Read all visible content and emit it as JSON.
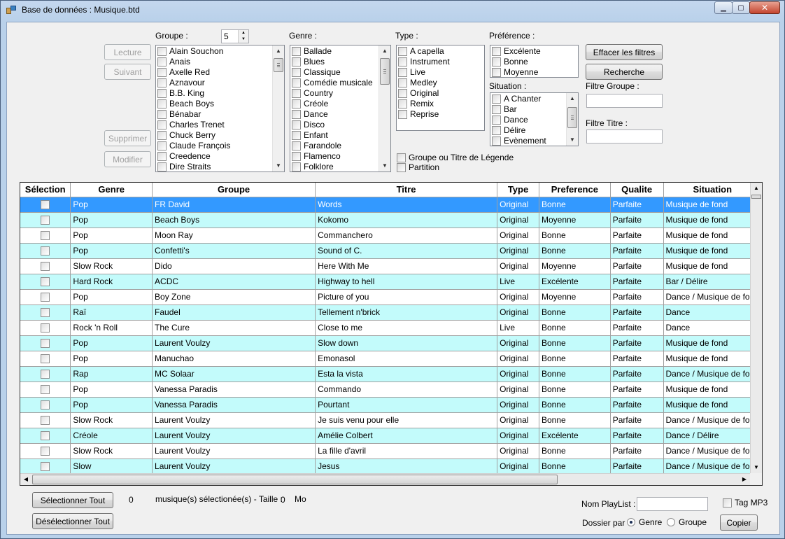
{
  "window": {
    "title": "Base de données : Musique.btd"
  },
  "left_buttons": {
    "lecture": "Lecture",
    "suivant": "Suivant",
    "supprimer": "Supprimer",
    "modifier": "Modifier"
  },
  "groupe": {
    "label": "Groupe :",
    "spinner_value": "5",
    "items": [
      "Alain Souchon",
      "Anais",
      "Axelle Red",
      "Aznavour",
      "B.B. King",
      "Beach Boys",
      "Bénabar",
      "Charles Trenet",
      "Chuck Berry",
      "Claude François",
      "Creedence",
      "Dire Straits"
    ]
  },
  "genre": {
    "label": "Genre :",
    "items": [
      "Ballade",
      "Blues",
      "Classique",
      "Comédie musicale",
      "Country",
      "Créole",
      "Dance",
      "Disco",
      "Enfant",
      "Farandole",
      "Flamenco",
      "Folklore"
    ]
  },
  "type": {
    "label": "Type :",
    "items": [
      "A capella",
      "Instrument",
      "Live",
      "Medley",
      "Original",
      "Remix",
      "Reprise"
    ]
  },
  "preference": {
    "label": "Préférence :",
    "items": [
      "Excélente",
      "Bonne",
      "Moyenne"
    ]
  },
  "situation": {
    "label": "Situation :",
    "items": [
      "A Chanter",
      "Bar",
      "Dance",
      "Délire",
      "Evènement"
    ]
  },
  "options": {
    "legende": "Groupe ou Titre de Légende",
    "partition": "Partition"
  },
  "right_panel": {
    "effacer": "Effacer les filtres",
    "recherche": "Recherche",
    "filtre_groupe": "Filtre Groupe :",
    "filtre_titre": "Filtre Titre :"
  },
  "grid": {
    "columns": [
      "Sélection",
      "Genre",
      "Groupe",
      "Titre",
      "Type",
      "Preference",
      "Qualite",
      "Situation"
    ],
    "rows": [
      [
        "Pop",
        "FR David",
        "Words",
        "Original",
        "Bonne",
        "Parfaite",
        "Musique de fond"
      ],
      [
        "Pop",
        "Beach Boys",
        "Kokomo",
        "Original",
        "Moyenne",
        "Parfaite",
        "Musique de fond"
      ],
      [
        "Pop",
        "Moon Ray",
        "Commanchero",
        "Original",
        "Bonne",
        "Parfaite",
        "Musique de fond"
      ],
      [
        "Pop",
        "Confetti's",
        "Sound of C.",
        "Original",
        "Bonne",
        "Parfaite",
        "Musique de fond"
      ],
      [
        "Slow Rock",
        "Dido",
        "Here With Me",
        "Original",
        "Moyenne",
        "Parfaite",
        "Musique de fond"
      ],
      [
        "Hard Rock",
        "ACDC",
        "Highway to hell",
        "Live",
        "Excélente",
        "Parfaite",
        "Bar / Délire"
      ],
      [
        "Pop",
        "Boy Zone",
        "Picture of you",
        "Original",
        "Moyenne",
        "Parfaite",
        "Dance / Musique de fond"
      ],
      [
        "Raï",
        "Faudel",
        "Tellement n'brick",
        "Original",
        "Bonne",
        "Parfaite",
        "Dance"
      ],
      [
        "Rock 'n Roll",
        "The Cure",
        "Close to me",
        "Live",
        "Bonne",
        "Parfaite",
        "Dance"
      ],
      [
        "Pop",
        "Laurent Voulzy",
        "Slow down",
        "Original",
        "Bonne",
        "Parfaite",
        "Musique de fond"
      ],
      [
        "Pop",
        "Manuchao",
        "Emonasol",
        "Original",
        "Bonne",
        "Parfaite",
        "Musique de fond"
      ],
      [
        "Rap",
        "MC Solaar",
        "Esta la vista",
        "Original",
        "Bonne",
        "Parfaite",
        "Dance / Musique de fond"
      ],
      [
        "Pop",
        "Vanessa Paradis",
        "Commando",
        "Original",
        "Bonne",
        "Parfaite",
        "Musique de fond"
      ],
      [
        "Pop",
        "Vanessa Paradis",
        "Pourtant",
        "Original",
        "Bonne",
        "Parfaite",
        "Musique de fond"
      ],
      [
        "Slow Rock",
        "Laurent Voulzy",
        "Je suis venu pour elle",
        "Original",
        "Bonne",
        "Parfaite",
        "Dance / Musique de fond"
      ],
      [
        "Créole",
        "Laurent Voulzy",
        "Amélie Colbert",
        "Original",
        "Excélente",
        "Parfaite",
        "Dance / Délire"
      ],
      [
        "Slow Rock",
        "Laurent Voulzy",
        "La fille d'avril",
        "Original",
        "Bonne",
        "Parfaite",
        "Dance / Musique de fond"
      ],
      [
        "Slow",
        "Laurent Voulzy",
        "Jesus",
        "Original",
        "Bonne",
        "Parfaite",
        "Dance / Musique de fond"
      ]
    ],
    "selected_row": 0
  },
  "footer": {
    "select_all": "Sélectionner Tout",
    "deselect_all": "Désélectionner Tout",
    "count": "0",
    "count_text": "musique(s) sélectionée(s) - Taille :",
    "size": "0",
    "unit": "Mo",
    "playlist_label": "Nom PlayList :",
    "tag_mp3": "Tag MP3",
    "dossier_par": "Dossier par",
    "radio_genre": "Genre",
    "radio_groupe": "Groupe",
    "copier": "Copier"
  },
  "colors": {
    "selected_row": "#3399ff",
    "alt_row": "#c3fbfb",
    "window_frame": "#b9d1ea"
  }
}
